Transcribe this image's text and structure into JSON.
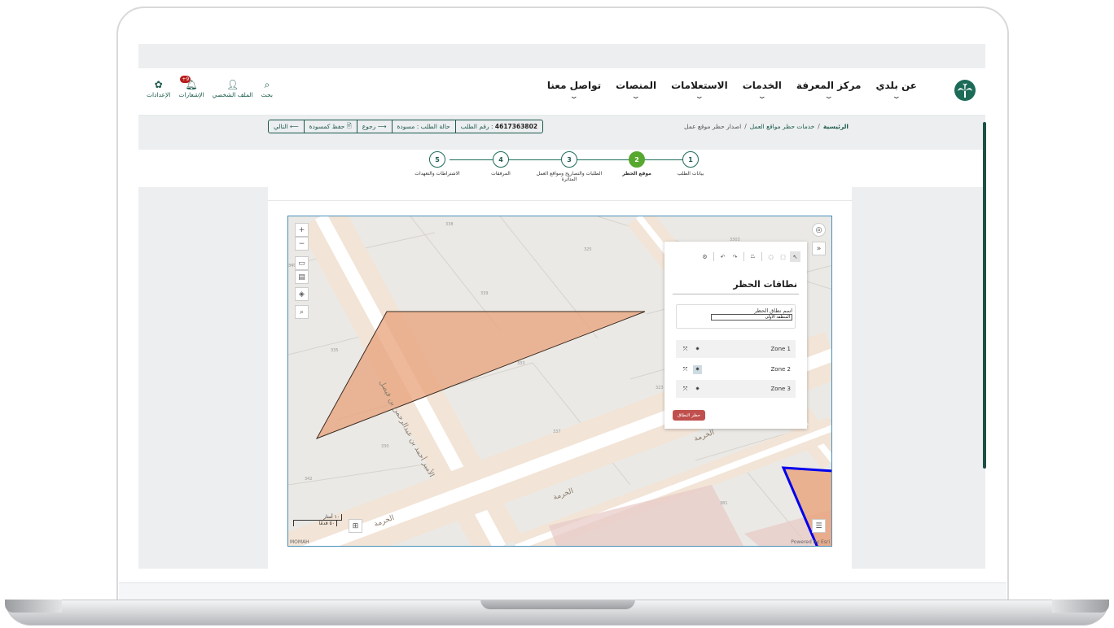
{
  "header": {
    "nav": [
      {
        "label": "عن بلدي"
      },
      {
        "label": "مركز المعرفة"
      },
      {
        "label": "الخدمات"
      },
      {
        "label": "الاستعلامات"
      },
      {
        "label": "المنصات"
      },
      {
        "label": "تواصل معنا"
      }
    ],
    "tools": {
      "search": "بحث",
      "profile": "الملف الشخصي",
      "notifications": "الإشعارات",
      "notifications_badge": "+9",
      "settings": "الإعدادات"
    }
  },
  "breadcrumb": {
    "home": "الرئيسية",
    "service": "خدمات حظر مواقع العمل",
    "current": "اصدار حظر موقع عمل",
    "sep": "/"
  },
  "actions": {
    "request_number_label": "رقم الطلب :",
    "request_number": "4617363802",
    "status": "حالة الطلب : مسودة",
    "back": "رجوع",
    "save_draft": "حفظ كمسودة",
    "next": "التالي"
  },
  "steps": [
    {
      "num": "1",
      "label": "بيانات الطلب"
    },
    {
      "num": "2",
      "label": "موقع الحظر"
    },
    {
      "num": "3",
      "label": "الطلبات والتصاريح ومواقع العمل المتأثرة"
    },
    {
      "num": "4",
      "label": "المرفقات"
    },
    {
      "num": "5",
      "label": "الاشتراطات والتعهدات"
    }
  ],
  "active_step": 2,
  "map": {
    "streets": [
      "الأمير أحمد بن عبدالرحمن بن فيصل",
      "الخرمة",
      "الخرمة",
      "الخرمة"
    ],
    "parcels": [
      "338",
      "325",
      "339",
      "333",
      "335",
      "330",
      "337",
      "342",
      "381",
      "323",
      "340",
      "3303"
    ],
    "scale_m": "١٠ أمتار",
    "scale_ft": "٥٠ قدمًا",
    "attribution": "Powered by Esri",
    "source": "MOMAH"
  },
  "panel": {
    "title": "نطاقات الحظر",
    "name_label": "اسم نطاق الحظر",
    "name_value": "المنطقة الأولى",
    "zones": [
      "Zone 1",
      "Zone 2",
      "Zone 3"
    ],
    "delete_label": "حظر النطاق"
  },
  "colors": {
    "brand": "#1c6b58",
    "active_step": "#56a82e",
    "polygon_fill": "#e8a27a",
    "selected_outline": "#0000ee",
    "delete_button": "#c0504d"
  }
}
